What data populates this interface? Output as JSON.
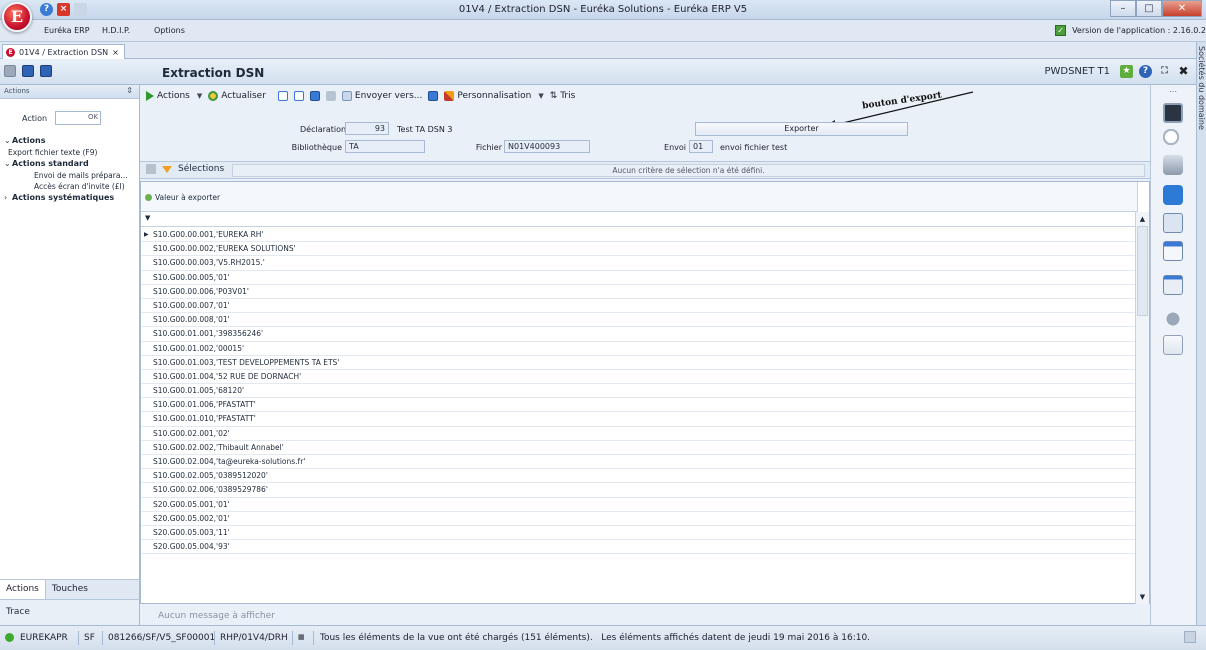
{
  "window": {
    "title": "01V4 / Extraction DSN - Euréka Solutions - Euréka ERP V5"
  },
  "menu": {
    "items": [
      "Euréka ERP",
      "H.D.I.P.",
      "Options"
    ],
    "version_label": "Version de l'application : 2.16.0.2"
  },
  "doc_tab": {
    "label": "01V4 / Extraction DSN",
    "close": "×"
  },
  "header": {
    "title": "Extraction DSN",
    "user": "PWDSNET T1"
  },
  "left_panel": {
    "header": "Actions",
    "action_label": "Action",
    "ok_label": "OK",
    "tree": {
      "actions": {
        "label": "Actions",
        "items": [
          "Export fichier texte (F9)"
        ]
      },
      "standard": {
        "label": "Actions standard",
        "items": [
          "Envoi de mails prépara...",
          "Accès écran d'invite (£I)"
        ]
      },
      "systematic": {
        "label": "Actions systématiques"
      }
    },
    "tabs": [
      "Actions",
      "Touches"
    ],
    "trace": "Trace"
  },
  "toolbar": {
    "actions": "Actions",
    "actualiser": "Actualiser",
    "envoyer": "Envoyer vers...",
    "personnalisation": "Personnalisation",
    "tris": "Tris"
  },
  "annotation": "bouton d'export",
  "form": {
    "declaration_label": "Déclaration",
    "declaration_value": "93",
    "declaration_text": "Test TA DSN 3",
    "bibliotheque_label": "Bibliothèque",
    "bibliotheque_value": "TA",
    "fichier_label": "Fichier",
    "fichier_value": "N01V400093",
    "envoi_label": "Envoi",
    "envoi_value": "01",
    "envoi_text": "envoi fichier test",
    "export_button": "Exporter"
  },
  "selection": {
    "label": "Sélections",
    "message": "Aucun critère de sélection n'a été défini."
  },
  "grid": {
    "column": "Valeur à exporter",
    "rows": [
      "S10.G00.00.001,'EUREKA RH'",
      "S10.G00.00.002,'EUREKA SOLUTIONS'",
      "S10.G00.00.003,'V5.RH2015.'",
      "S10.G00.00.005,'01'",
      "S10.G00.00.006,'P03V01'",
      "S10.G00.00.007,'01'",
      "S10.G00.00.008,'01'",
      "S10.G00.01.001,'398356246'",
      "S10.G00.01.002,'00015'",
      "S10.G00.01.003,'TEST DEVELOPPEMENTS TA ETS'",
      "S10.G00.01.004,'52 RUE DE DORNACH'",
      "S10.G00.01.005,'68120'",
      "S10.G00.01.006,'PFASTATT'",
      "S10.G00.01.010,'PFASTATT'",
      "S10.G00.02.001,'02'",
      "S10.G00.02.002,'Thibault Annabel'",
      "S10.G00.02.004,'ta@eureka-solutions.fr'",
      "S10.G00.02.005,'0389512020'",
      "S10.G00.02.006,'0389529786'",
      "S20.G00.05.001,'01'",
      "S20.G00.05.002,'01'",
      "S20.G00.05.003,'11'",
      "S20.G00.05.004,'93'"
    ]
  },
  "message_bar": "Aucun message à afficher",
  "side_strip": "Sociétés du domaine",
  "status": {
    "env": "EUREKAPR",
    "sf": "SF",
    "session": "081266/SF/V5_SF00001",
    "path": "RHP/01V4/DRH",
    "message": "Tous les éléments de la vue ont été chargés (151 éléments).   Les éléments affichés datent de jeudi 19 mai 2016 à 16:10."
  }
}
